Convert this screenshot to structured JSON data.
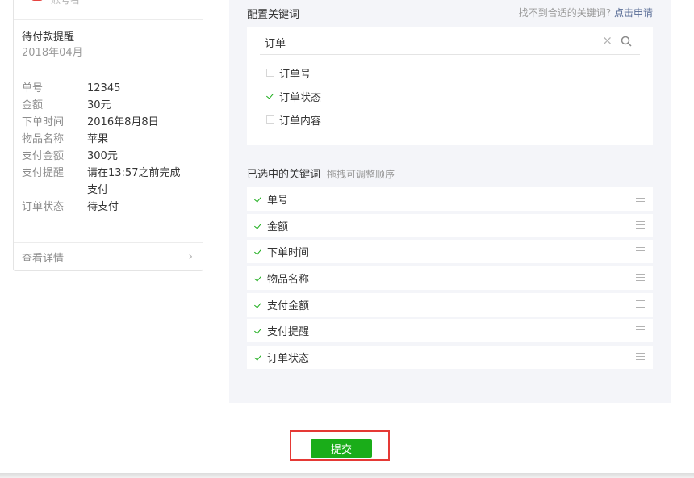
{
  "preview": {
    "account_name": "账号名",
    "title": "待付款提醒",
    "date": "2018年04月",
    "fields": [
      {
        "key": "单号",
        "value": "12345"
      },
      {
        "key": "金额",
        "value": "30元"
      },
      {
        "key": "下单时间",
        "value": "2016年8月8日"
      },
      {
        "key": "物品名称",
        "value": "苹果"
      },
      {
        "key": "支付金额",
        "value": "300元"
      },
      {
        "key": "支付提醒",
        "value": "请在13:57之前完成支付"
      },
      {
        "key": "订单状态",
        "value": "待支付"
      }
    ],
    "detail_link": "查看详情",
    "chevron": "›"
  },
  "config": {
    "section_title": "配置关键词",
    "help_text": "找不到合适的关键词?",
    "help_link": "点击申请",
    "search_value": "订单",
    "clear_icon": "×",
    "options": [
      {
        "label": "订单号",
        "checked": false
      },
      {
        "label": "订单状态",
        "checked": true
      },
      {
        "label": "订单内容",
        "checked": false
      }
    ],
    "selected_title": "已选中的关键词",
    "selected_hint": "拖拽可调整顺序",
    "selected": [
      "单号",
      "金额",
      "下单时间",
      "物品名称",
      "支付金额",
      "支付提醒",
      "订单状态"
    ]
  },
  "actions": {
    "submit_label": "提交"
  },
  "colors": {
    "accent_green": "#1aad19",
    "link_blue": "#576b95",
    "highlight_red": "#e53935",
    "panel_bg": "#f4f5f9"
  }
}
